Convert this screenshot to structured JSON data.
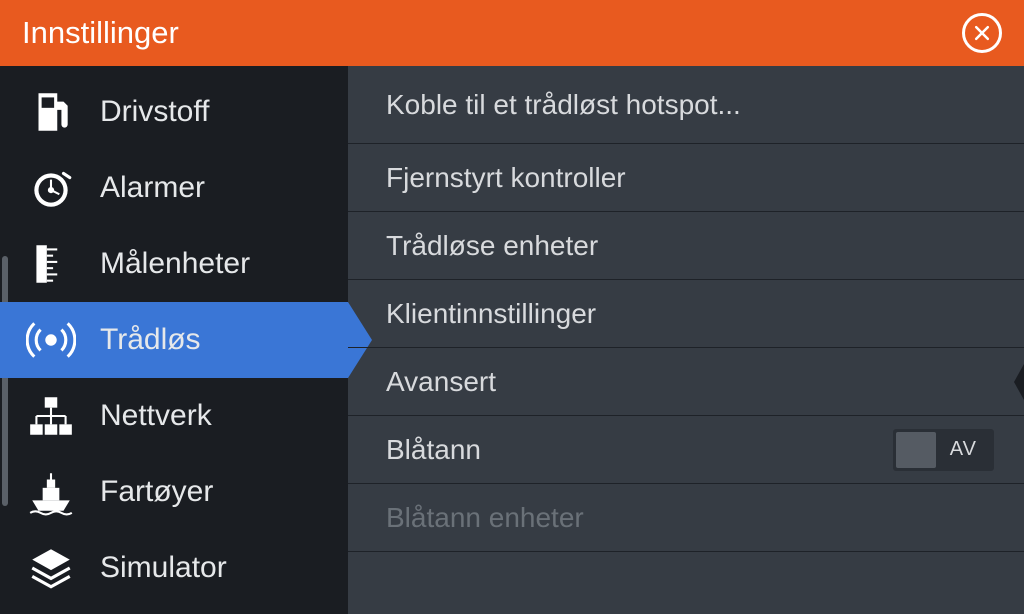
{
  "header": {
    "title": "Innstillinger"
  },
  "sidebar": {
    "items": [
      {
        "label": "Drivstoff",
        "icon": "fuel"
      },
      {
        "label": "Alarmer",
        "icon": "alarm"
      },
      {
        "label": "Målenheter",
        "icon": "ruler"
      },
      {
        "label": "Trådløs",
        "icon": "wireless",
        "selected": true
      },
      {
        "label": "Nettverk",
        "icon": "network"
      },
      {
        "label": "Fartøyer",
        "icon": "vessel"
      },
      {
        "label": "Simulator",
        "icon": "layers"
      }
    ]
  },
  "main": {
    "items": [
      {
        "label": "Koble til et trådløst hotspot..."
      },
      {
        "label": "Fjernstyrt kontroller"
      },
      {
        "label": "Trådløse enheter"
      },
      {
        "label": "Klientinnstillinger"
      },
      {
        "label": "Avansert",
        "chevron": true
      },
      {
        "label": "Blåtann",
        "toggle": {
          "state": "AV"
        }
      },
      {
        "label": "Blåtann enheter",
        "disabled": true
      }
    ]
  }
}
